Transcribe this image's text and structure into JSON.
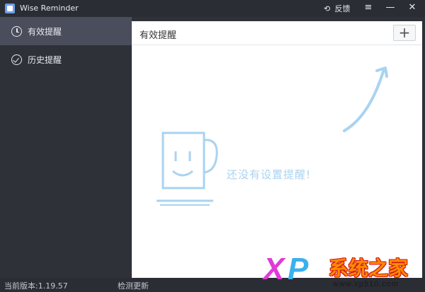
{
  "window": {
    "title": "Wise Reminder",
    "feedback_label": "反馈",
    "menu_icon": "menu-icon",
    "minimize_icon": "minimize-icon",
    "close_icon": "close-icon"
  },
  "sidebar": {
    "items": [
      {
        "label": "有效提醒",
        "icon": "clock-icon",
        "active": true
      },
      {
        "label": "历史提醒",
        "icon": "check-circle-icon",
        "active": false
      }
    ]
  },
  "main": {
    "title": "有效提醒",
    "add_button": "+",
    "empty_message": "还没有设置提醒!"
  },
  "status": {
    "version": "当前版本:1.19.57",
    "check_update": "检测更新"
  },
  "watermark": {
    "x": "X",
    "p": "P",
    "main": "系统之家",
    "url": "www.xp510.com"
  },
  "colors": {
    "accent_blue": "#a9d3f0",
    "sidebar_bg": "#2f3139",
    "active_item_bg": "#4a4d5b"
  }
}
